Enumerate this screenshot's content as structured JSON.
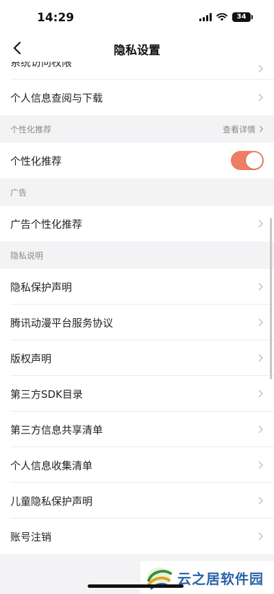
{
  "status": {
    "time": "14:29",
    "battery": "34"
  },
  "nav": {
    "title": "隐私设置"
  },
  "rows_top": [
    {
      "label": "系统访问权限"
    },
    {
      "label": "个人信息查阅与下载"
    }
  ],
  "personalize": {
    "section_title": "个性化推荐",
    "section_link": "查看详情",
    "row_label": "个性化推荐",
    "toggle_on": true
  },
  "ads": {
    "section_title": "广告",
    "row_label": "广告个性化推荐"
  },
  "privacy": {
    "section_title": "隐私说明",
    "items": [
      {
        "label": "隐私保护声明"
      },
      {
        "label": "腾讯动漫平台服务协议"
      },
      {
        "label": "版权声明"
      },
      {
        "label": "第三方SDK目录"
      },
      {
        "label": "第三方信息共享清单"
      },
      {
        "label": "个人信息收集清单"
      },
      {
        "label": "儿童隐私保护声明"
      },
      {
        "label": "账号注销"
      }
    ]
  },
  "watermark": {
    "text": "云之居软件园"
  },
  "colors": {
    "accent": "#ee7e61",
    "background": "#f3f3f5"
  }
}
